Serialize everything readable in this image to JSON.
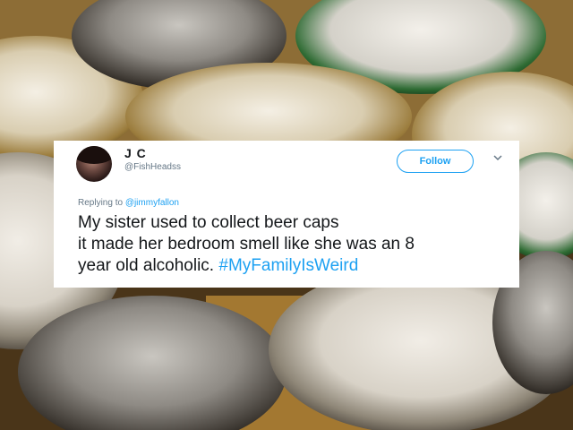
{
  "colors": {
    "accent": "#1da1f2",
    "text": "#14171a",
    "muted": "#657786"
  },
  "tweet": {
    "name": "J C",
    "handle": "@FishHeadss",
    "follow_label": "Follow",
    "reply_prefix": "Replying to",
    "reply_mention": "@jimmyfallon",
    "text_lines": [
      "My sister used to collect beer caps",
      "it made her bedroom smell like she was an 8",
      "year old alcoholic."
    ],
    "hashtag": "#MyFamilyIsWeird",
    "icons": [
      "avatar",
      "chevron-down-icon"
    ]
  }
}
